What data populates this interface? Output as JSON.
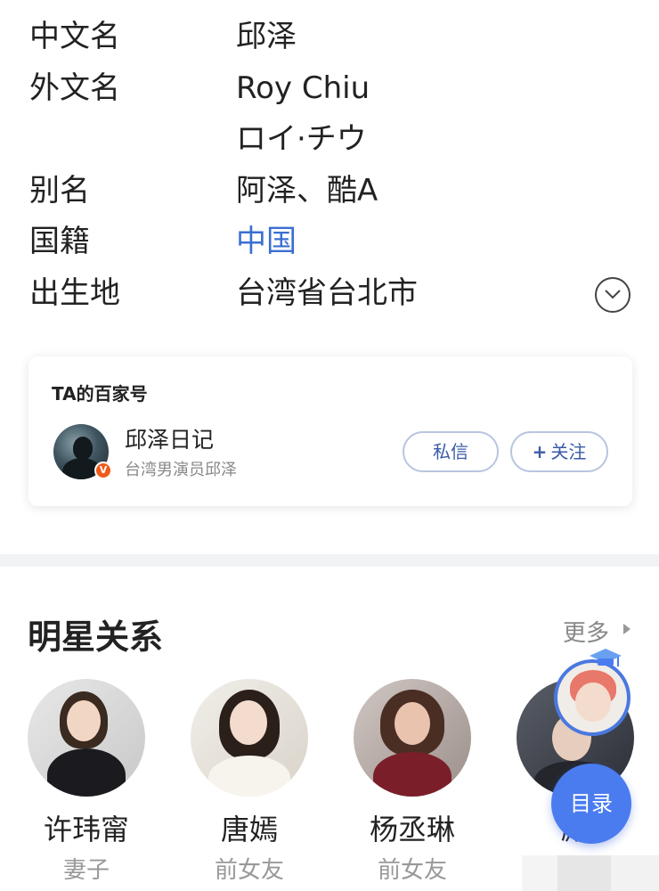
{
  "info": {
    "rows": [
      {
        "label": "中文名",
        "value": "邱泽"
      },
      {
        "label": "外文名",
        "value": "Roy Chiu"
      },
      {
        "label": "",
        "value": "ロイ·チウ"
      },
      {
        "label": "别名",
        "value": "阿泽、酷A"
      },
      {
        "label": "国籍",
        "value": "中国"
      },
      {
        "label": "出生地",
        "value": "台湾省台北市"
      }
    ],
    "expand_icon": "chevron-down-icon"
  },
  "baijiahao": {
    "title": "TA的百家号",
    "account_name": "邱泽日记",
    "account_desc": "台湾男演员邱泽",
    "message_label": "私信",
    "follow_label": "关注",
    "verified_badge": "V"
  },
  "relations": {
    "title": "明星关系",
    "more_label": "更多",
    "people": [
      {
        "name": "许玮甯",
        "relation": "妻子"
      },
      {
        "name": "唐嫣",
        "relation": "前女友"
      },
      {
        "name": "杨丞琳",
        "relation": "前女友"
      },
      {
        "name": "殿",
        "relation": ""
      }
    ]
  },
  "toc_button": "目录",
  "colors": {
    "link": "#3a6fd0",
    "accent": "#4a7cf0",
    "pill_text": "#3a5aa8",
    "badge": "#f05a1a"
  }
}
